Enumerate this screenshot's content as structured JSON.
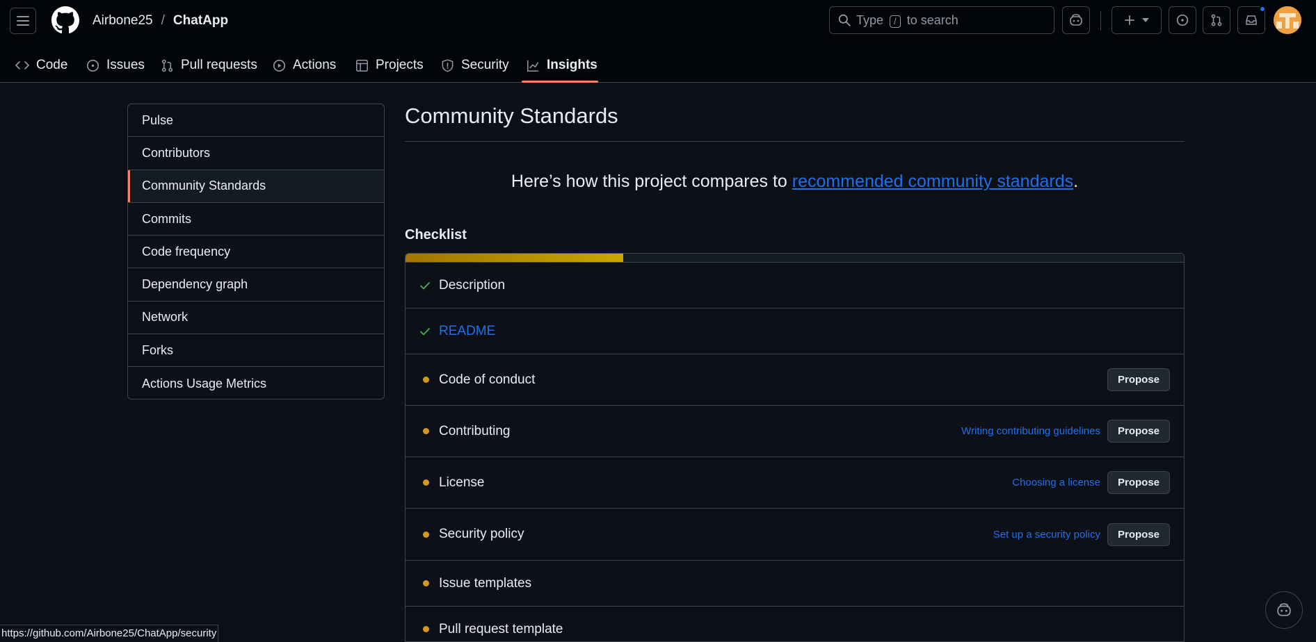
{
  "header": {
    "owner": "Airbone25",
    "separator": "/",
    "repo": "ChatApp",
    "search_prefix": "Type",
    "search_key": "/",
    "search_suffix": "to search"
  },
  "tabs": [
    {
      "label": "Code",
      "icon": "code-icon"
    },
    {
      "label": "Issues",
      "icon": "issue-icon"
    },
    {
      "label": "Pull requests",
      "icon": "pull-request-icon"
    },
    {
      "label": "Actions",
      "icon": "play-icon"
    },
    {
      "label": "Projects",
      "icon": "table-icon"
    },
    {
      "label": "Security",
      "icon": "shield-icon"
    },
    {
      "label": "Insights",
      "icon": "graph-icon",
      "active": true
    }
  ],
  "sidebar": {
    "items": [
      {
        "label": "Pulse"
      },
      {
        "label": "Contributors"
      },
      {
        "label": "Community Standards",
        "active": true
      },
      {
        "label": "Commits"
      },
      {
        "label": "Code frequency"
      },
      {
        "label": "Dependency graph"
      },
      {
        "label": "Network"
      },
      {
        "label": "Forks"
      },
      {
        "label": "Actions Usage Metrics"
      }
    ]
  },
  "main": {
    "title": "Community Standards",
    "compare_text": "Here’s how this project compares to",
    "compare_link": "recommended community standards",
    "compare_end": ".",
    "checklist_title": "Checklist",
    "progress_fraction": 0.28,
    "items": [
      {
        "label": "Description",
        "status": "done"
      },
      {
        "label": "README",
        "status": "done"
      },
      {
        "label": "Code of conduct",
        "status": "todo",
        "button": "Propose"
      },
      {
        "label": "Contributing",
        "status": "todo",
        "helper": "Writing contributing guidelines",
        "button": "Propose"
      },
      {
        "label": "License",
        "status": "todo",
        "helper": "Choosing a license",
        "button": "Propose"
      },
      {
        "label": "Security policy",
        "status": "todo",
        "helper": "Set up a security policy",
        "button": "Propose"
      },
      {
        "label": "Issue templates",
        "status": "todo"
      },
      {
        "label": "Pull request template",
        "status": "todo"
      }
    ]
  },
  "status_bar": {
    "url": "https://github.com/Airbone25/ChatApp/security"
  },
  "colors": {
    "accent": "#f78166",
    "link": "#1f6feb",
    "done": "#3fb950",
    "todo": "#d29922"
  }
}
